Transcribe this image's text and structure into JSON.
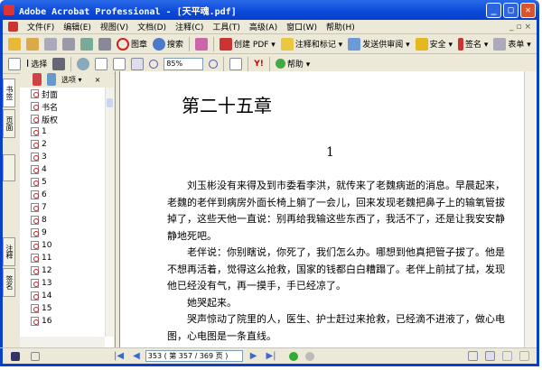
{
  "window": {
    "title": "Adobe Acrobat Professional - [天平魂.pdf]",
    "minimize": "_",
    "maximize": "□",
    "close": "✕"
  },
  "menu": [
    "文件(F)",
    "编辑(E)",
    "视图(V)",
    "文档(D)",
    "注释(C)",
    "工具(T)",
    "高级(A)",
    "窗口(W)",
    "帮助(H)"
  ],
  "menu_right": "_ ▫ ×",
  "toolbar1": {
    "stamp": "图章",
    "search": "搜索",
    "create_pdf": "创建 PDF ▾",
    "comment": "注释和标记 ▾",
    "review": "发送供审阅 ▾",
    "security": "安全 ▾",
    "sign": "签名 ▾",
    "forms": "表单 ▾"
  },
  "toolbar2": {
    "select": "选择",
    "zoom_value": "85%",
    "help": "帮助 ▾",
    "yahoo": "Y!"
  },
  "nav": {
    "tabs": [
      "书签",
      "页面",
      "",
      "注释",
      "签名"
    ],
    "options": "选项 ▾",
    "close": "×",
    "items": [
      "封面",
      "书名",
      "版权",
      "1",
      "2",
      "3",
      "4",
      "5",
      "6",
      "7",
      "8",
      "9",
      "10",
      "11",
      "12",
      "13",
      "14",
      "15",
      "16"
    ]
  },
  "doc": {
    "chapter": "第二十五章",
    "page_number": "1",
    "paragraphs": [
      "刘玉彬没有来得及到市委看李洪，就传来了老魏病逝的消息。早晨起来，老魏的老伴到病房外面长椅上躺了一会儿，回来发现老魏把鼻子上的输氧管拔掉了，这些天他一直说：别再给我输这些东西了，我活不了，还是让我安安静静地死吧。",
      "老伴说：你别瞎说，你死了，我们怎么办。哪想到他真把管子拔了。他是不想再活着，觉得这么抢救，国家的钱都白白糟蹋了。老伴上前拭了拭，发现他已经没有气，再一摸手，手已经凉了。",
      "她哭起来。",
      "哭声惊动了院里的人，医生、护士赶过来抢救，已经滴不进液了，做心电图，心电图是一条直线。"
    ]
  },
  "status": {
    "page_field": "353 ( 第 357 / 369 页 )"
  }
}
